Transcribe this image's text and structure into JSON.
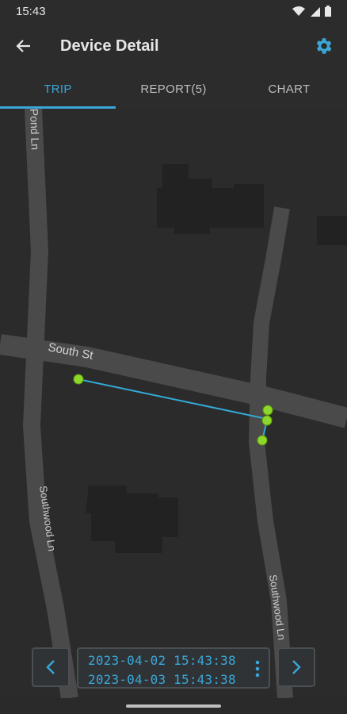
{
  "status": {
    "time": "15:43",
    "wifi_icon": "wifi-icon",
    "signal_icon": "signal-icon",
    "battery_icon": "battery-icon"
  },
  "appbar": {
    "title": "Device Detail",
    "back_icon": "arrow-left-icon",
    "settings_icon": "gear-icon",
    "accent": "#3aa7d8"
  },
  "tabs": [
    {
      "label": "TRIP",
      "active": true
    },
    {
      "label": "REPORT(5)",
      "active": false
    },
    {
      "label": "CHART",
      "active": false
    }
  ],
  "map": {
    "streets": [
      "Pond Ln",
      "South St",
      "Southwood Ln",
      "Southwood Ln"
    ],
    "route_color": "#33aad7",
    "point_color": "#8dd62a"
  },
  "controls": {
    "start_datetime": "2023-04-02 15:43:38",
    "end_datetime": "2023-04-03 15:43:38",
    "prev_icon": "chevron-left-icon",
    "next_icon": "chevron-right-icon",
    "menu_icon": "more-vert-icon"
  }
}
